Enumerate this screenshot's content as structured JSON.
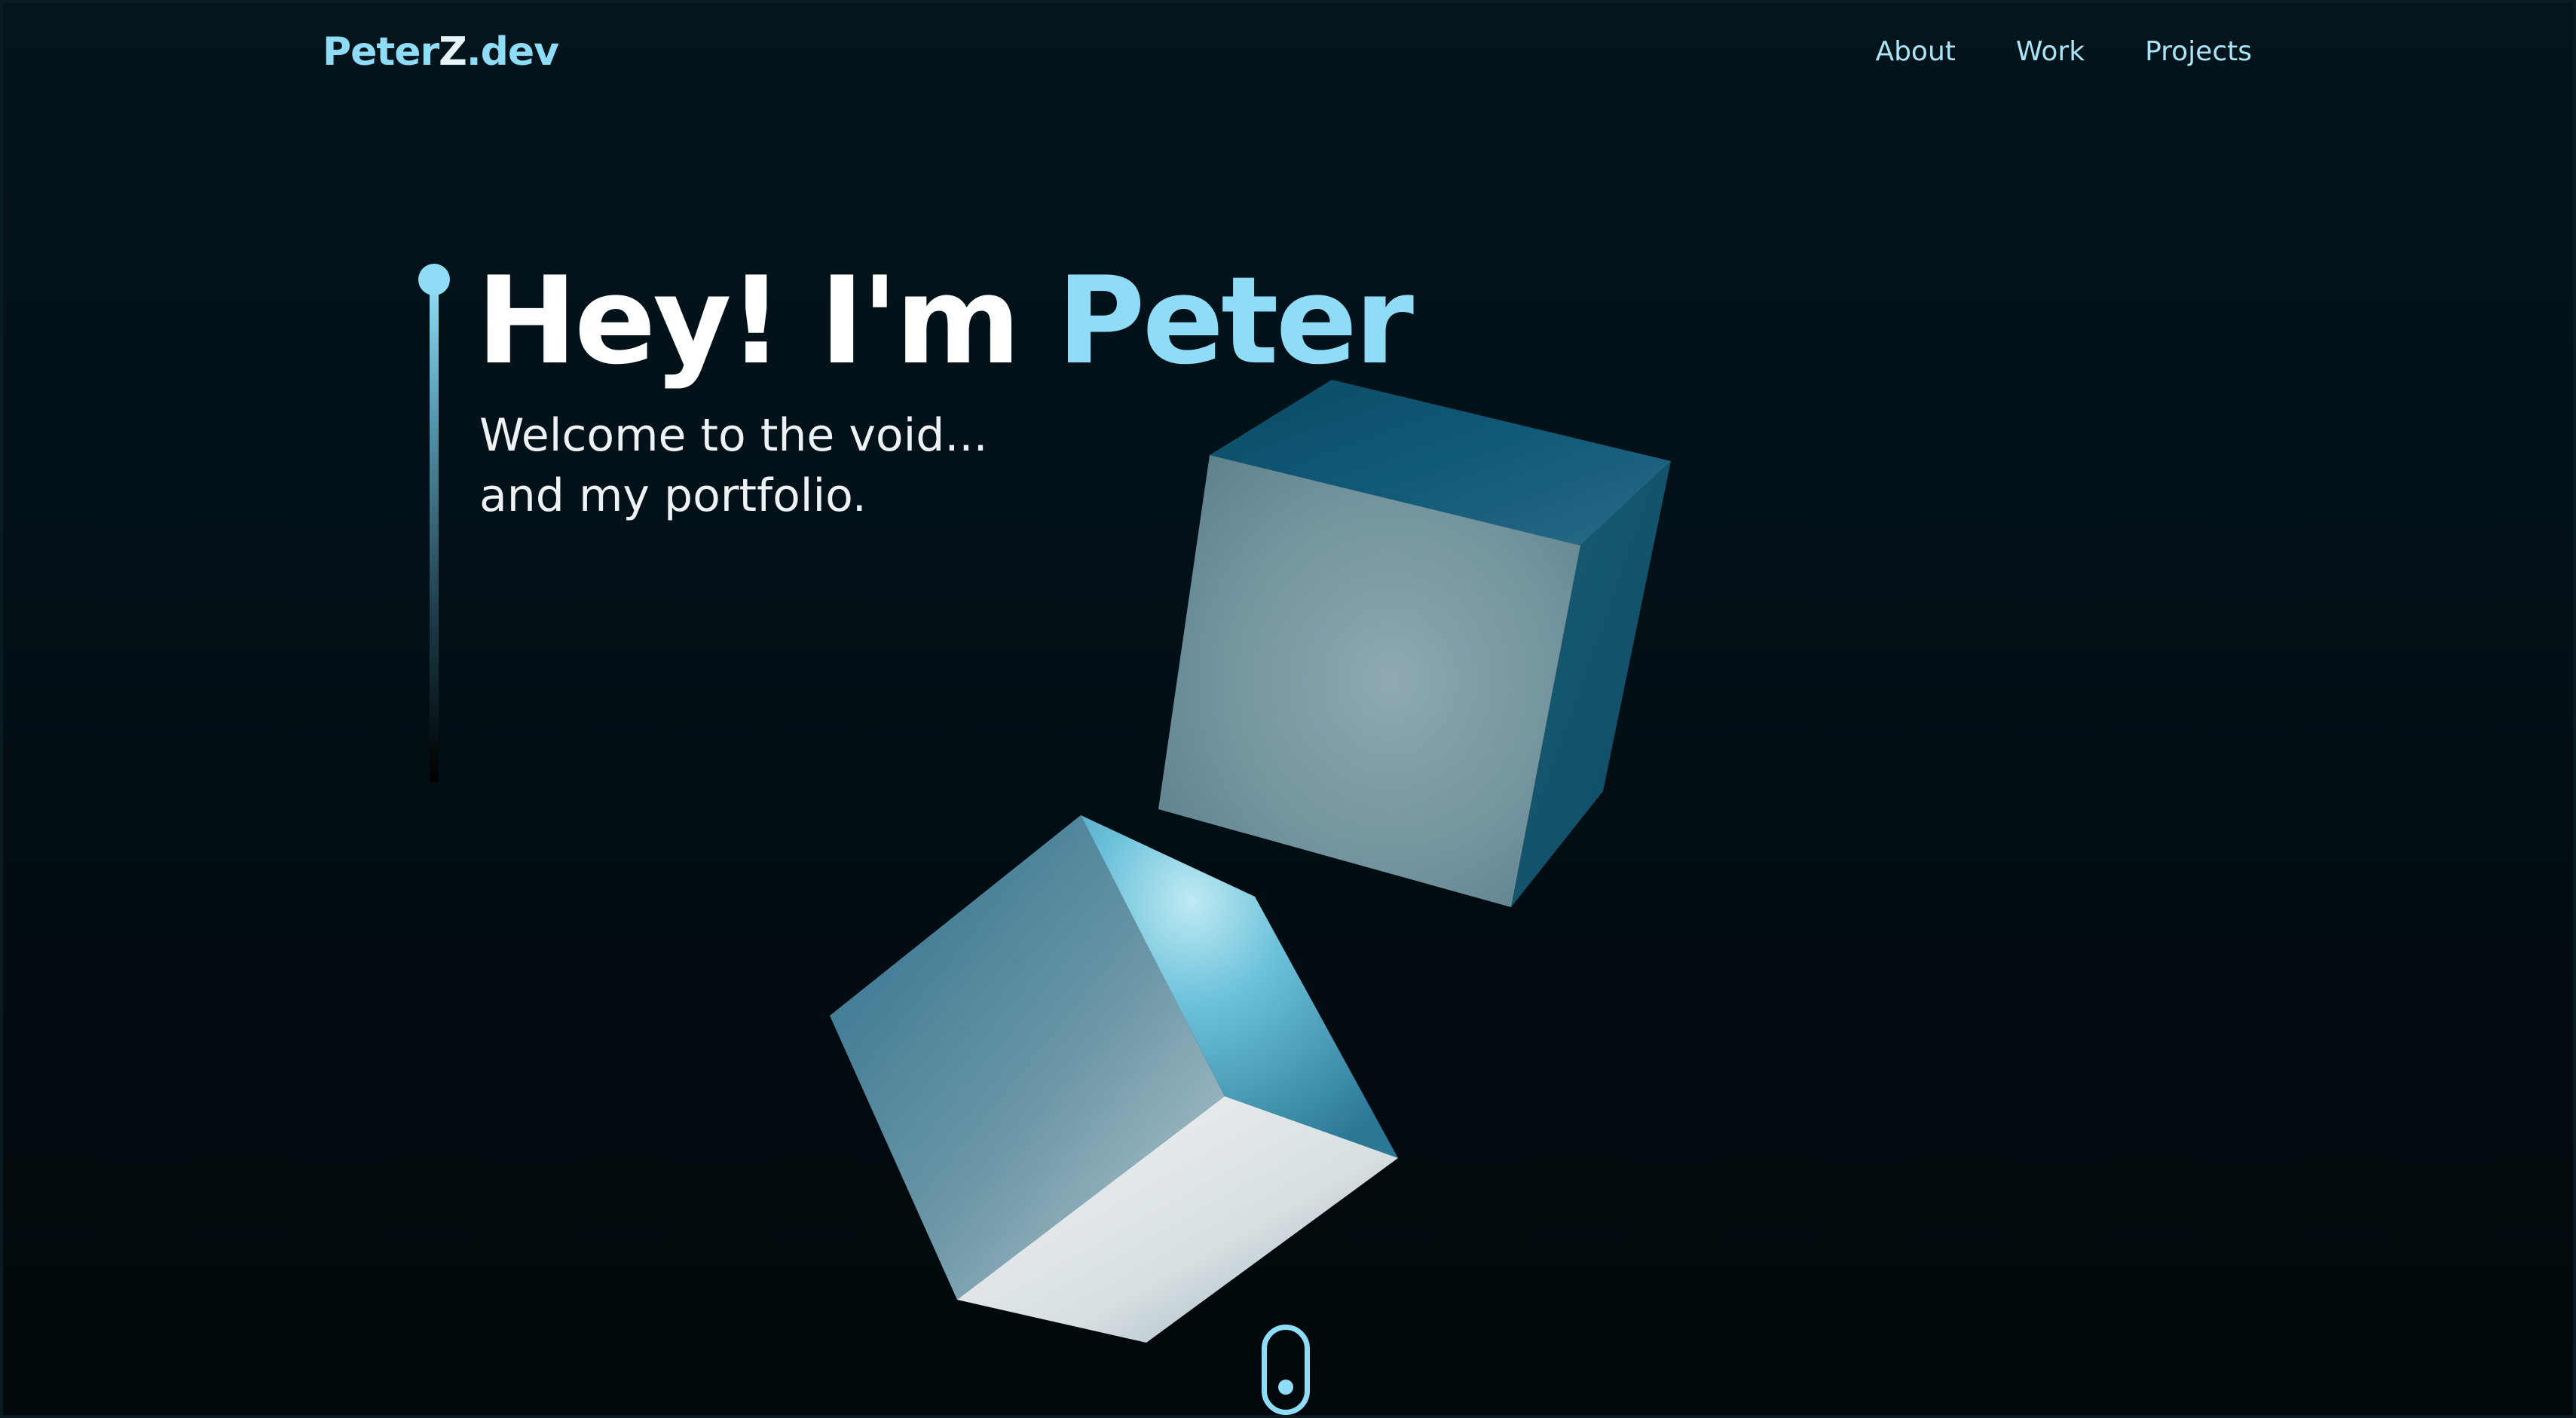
{
  "nav": {
    "logo": {
      "part1": "Peter",
      "part2": "Z",
      "part3": ".dev"
    },
    "links": [
      {
        "label": "About"
      },
      {
        "label": "Work"
      },
      {
        "label": "Projects"
      }
    ]
  },
  "hero": {
    "greeting": "Hey! I'm ",
    "name": "Peter",
    "subtitle_line1": "Welcome to the void...",
    "subtitle_line2": "and my portfolio."
  },
  "decor": {
    "cubes": [
      "cube-upper-right",
      "cube-lower-left"
    ],
    "scroll_icon": "mouse-scroll-icon"
  },
  "colors": {
    "accent": "#8fdcf7",
    "background": "#020b10",
    "text": "#ffffff"
  }
}
